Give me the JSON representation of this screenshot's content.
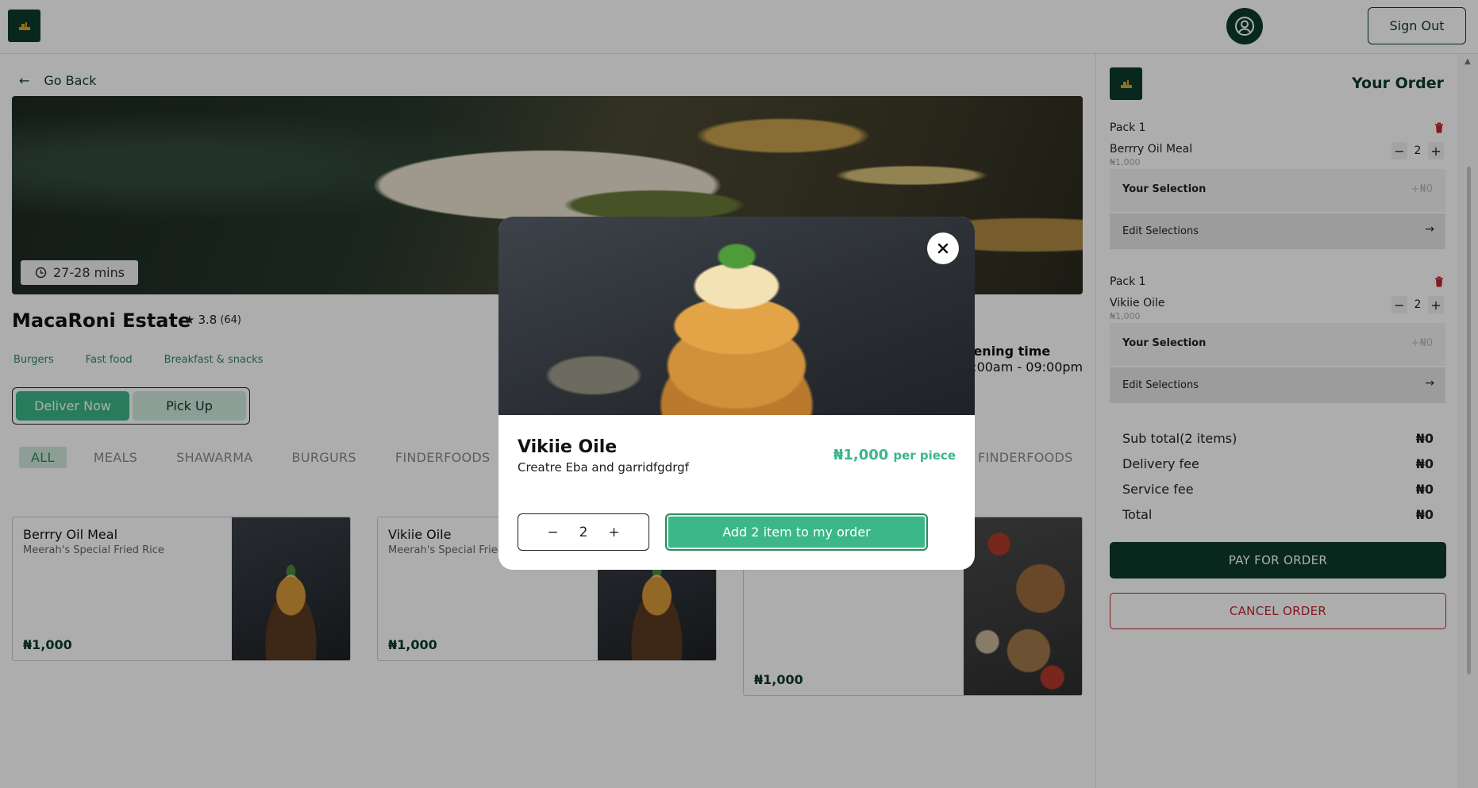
{
  "header": {
    "sign_out_label": "Sign Out"
  },
  "nav": {
    "go_back_label": "Go Back"
  },
  "restaurant": {
    "delivery_time": "27-28 mins",
    "name": "MacaRoni Estate",
    "rating": "3.8",
    "rating_count": "(64)",
    "tags": [
      "Burgers",
      "Fast food",
      "Breakfast & snacks"
    ],
    "opening_label": "pening time",
    "opening_hours": "9:00am - 09:00pm"
  },
  "mode": {
    "deliver_label": "Deliver Now",
    "pickup_label": "Pick Up",
    "selected": "Deliver Now"
  },
  "categories": [
    "ALL",
    "MEALS",
    "SHAWARMA",
    "BURGURS",
    "FINDERFOODS"
  ],
  "categories_extra": "FINDERFOODS",
  "menu": [
    {
      "title": "Berrry Oil Meal",
      "subtitle": "Meerah's Special Fried Rice",
      "price": "₦1,000"
    },
    {
      "title": "Vikiie Oile",
      "subtitle": "Meerah's Special Fried",
      "price": "₦1,000"
    },
    {
      "title": "",
      "subtitle": "",
      "price": "₦1,000"
    }
  ],
  "order": {
    "title": "Your Order",
    "packs": [
      {
        "label": "Pack 1",
        "item": "Berrry Oil Meal",
        "item_price": "₦1,000",
        "qty": "2",
        "selection_label": "Your Selection",
        "selection_value": "+₦0",
        "edit_label": "Edit Selections"
      },
      {
        "label": "Pack 1",
        "item": "Vikiie Oile",
        "item_price": "₦1,000",
        "qty": "2",
        "selection_label": "Your Selection",
        "selection_value": "+₦0",
        "edit_label": "Edit Selections"
      }
    ],
    "summary": {
      "subtotal_label": "Sub total(2 items)",
      "subtotal_value": "₦0",
      "delivery_label": "Delivery fee",
      "delivery_value": "₦0",
      "service_label": "Service fee",
      "service_value": "₦0",
      "total_label": "Total",
      "total_value": "₦0"
    },
    "pay_label": "PAY FOR ORDER",
    "cancel_label": "CANCEL ORDER"
  },
  "modal": {
    "title": "Vikiie Oile",
    "description": "Creatre Eba and garridfgdrgf",
    "price": "₦1,000",
    "price_unit": "per piece",
    "qty": "2",
    "add_label": "Add 2 item to my order"
  },
  "colors": {
    "brand_dark": "#0d3b2b",
    "accent_green": "#3bb78a",
    "danger_red": "#c0262d"
  }
}
